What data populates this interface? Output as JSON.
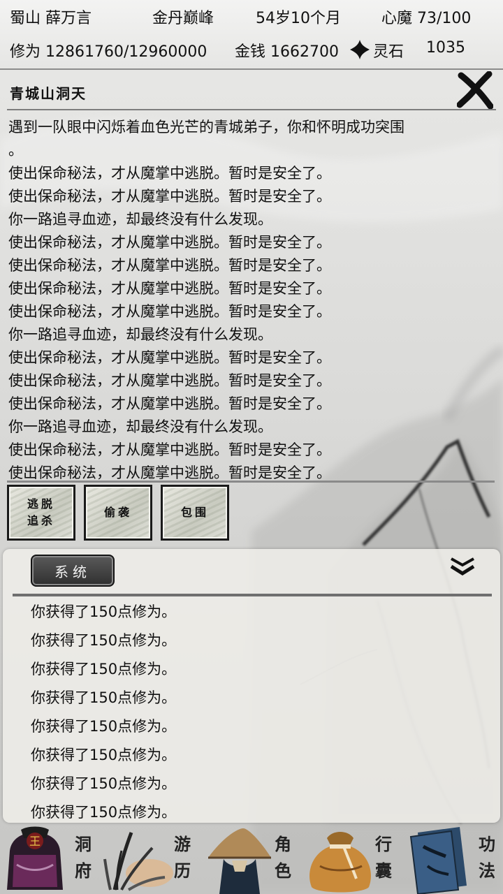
{
  "status": {
    "name": "蜀山 薛万言",
    "realm": "金丹巅峰",
    "age": "54岁10个月",
    "heart_demon": "心魔  73/100",
    "cultivation": "修为 12861760/12960000",
    "money": "金钱 1662700",
    "spirit_stone_label": "灵石",
    "spirit_stone_value": "1035"
  },
  "panel": {
    "title": "青城山洞天",
    "story_lines": [
      "遇到一队眼中闪烁着血色光芒的青城弟子，你和怀明成功突围",
      "。",
      "使出保命秘法，才从魔掌中逃脱。暂时是安全了。",
      "使出保命秘法，才从魔掌中逃脱。暂时是安全了。",
      "你一路追寻血迹，却最终没有什么发现。",
      "使出保命秘法，才从魔掌中逃脱。暂时是安全了。",
      "使出保命秘法，才从魔掌中逃脱。暂时是安全了。",
      "使出保命秘法，才从魔掌中逃脱。暂时是安全了。",
      "使出保命秘法，才从魔掌中逃脱。暂时是安全了。",
      "你一路追寻血迹，却最终没有什么发现。",
      "使出保命秘法，才从魔掌中逃脱。暂时是安全了。",
      "使出保命秘法，才从魔掌中逃脱。暂时是安全了。",
      "使出保命秘法，才从魔掌中逃脱。暂时是安全了。",
      "你一路追寻血迹，却最终没有什么发现。",
      "使出保命秘法，才从魔掌中逃脱。暂时是安全了。",
      "使出保命秘法，才从魔掌中逃脱。暂时是安全了。"
    ]
  },
  "actions": {
    "escape_line1": "逃脱",
    "escape_line2": "追杀",
    "ambush": "偷袭",
    "surround": "包围"
  },
  "system": {
    "tab_label": "系统",
    "lines": [
      "你获得了150点修为。",
      "你获得了150点修为。",
      "你获得了150点修为。",
      "你获得了150点修为。",
      "你获得了150点修为。",
      "你获得了150点修为。",
      "你获得了150点修为。",
      "你获得了150点修为。"
    ]
  },
  "nav": {
    "cave": [
      "洞",
      "府"
    ],
    "travel": [
      "游",
      "历"
    ],
    "character": [
      "角",
      "色"
    ],
    "bag": [
      "行",
      "囊"
    ],
    "skills": [
      "功",
      "法"
    ],
    "seal_text": "王"
  }
}
